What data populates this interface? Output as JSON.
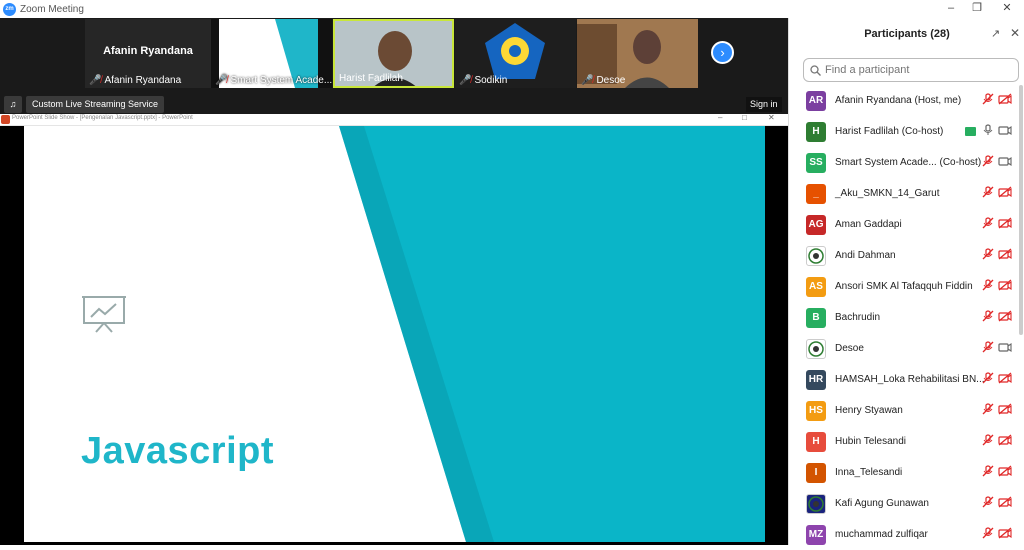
{
  "window": {
    "title": "Zoom Meeting",
    "app_icon": "zm"
  },
  "gallery": {
    "active_speaker": "Afanin Ryandana",
    "tiles": [
      {
        "label": "Afanin Ryandana",
        "muted": true
      },
      {
        "label": "Smart System Acade...",
        "muted": true
      },
      {
        "label": "Harist Fadlilah",
        "muted": false
      },
      {
        "label": "Sodikin",
        "muted": true
      },
      {
        "label": "Desoe",
        "muted": true
      }
    ]
  },
  "streaming": {
    "label": "Custom Live Streaming Service",
    "signin": "Sign in"
  },
  "ppt": {
    "window_title": "PowerPoint Slide Show - [Pengenalan Javascript.pptx] - PowerPoint"
  },
  "slide": {
    "title": "Javascript",
    "accent": "#1fb6c9"
  },
  "panel": {
    "title": "Participants (28)",
    "search_placeholder": "Find a participant",
    "participants": [
      {
        "initials": "AR",
        "name": "Afanin Ryandana (Host, me)",
        "color": "#7b3fa0",
        "video": "off"
      },
      {
        "initials": "H",
        "name": "Harist Fadlilah (Co-host)",
        "color": "#2e7d32",
        "video": "on",
        "sharing": true
      },
      {
        "initials": "SS",
        "name": "Smart System Acade...   (Co-host)",
        "color": "#27ae60",
        "video": "on"
      },
      {
        "initials": "_",
        "name": "_Aku_SMKN_14_Garut",
        "color": "#e65100",
        "video": "off"
      },
      {
        "initials": "AG",
        "name": "Aman Gaddapi",
        "color": "#c62828",
        "video": "off"
      },
      {
        "initials": "",
        "name": "Andi Dahman",
        "color": "#ffffff",
        "video": "off",
        "photo": true
      },
      {
        "initials": "AS",
        "name": "Ansori SMK Al Tafaqquh Fiddin",
        "color": "#f39c12",
        "video": "off"
      },
      {
        "initials": "B",
        "name": "Bachrudin",
        "color": "#27ae60",
        "video": "off"
      },
      {
        "initials": "",
        "name": "Desoe",
        "color": "#ffffff",
        "video": "on",
        "photo": true
      },
      {
        "initials": "HR",
        "name": "HAMSAH_Loka Rehabilitasi BN...",
        "color": "#34495e",
        "video": "off"
      },
      {
        "initials": "HS",
        "name": "Henry Styawan",
        "color": "#f39c12",
        "video": "off"
      },
      {
        "initials": "H",
        "name": "Hubin Telesandi",
        "color": "#e74c3c",
        "video": "off"
      },
      {
        "initials": "I",
        "name": "Inna_Telesandi",
        "color": "#d35400",
        "video": "off"
      },
      {
        "initials": "",
        "name": "Kafi Agung Gunawan",
        "color": "#1a237e",
        "video": "off",
        "photo": true
      },
      {
        "initials": "MZ",
        "name": "muchammad zulfiqar",
        "color": "#8e44ad",
        "video": "off"
      }
    ]
  }
}
